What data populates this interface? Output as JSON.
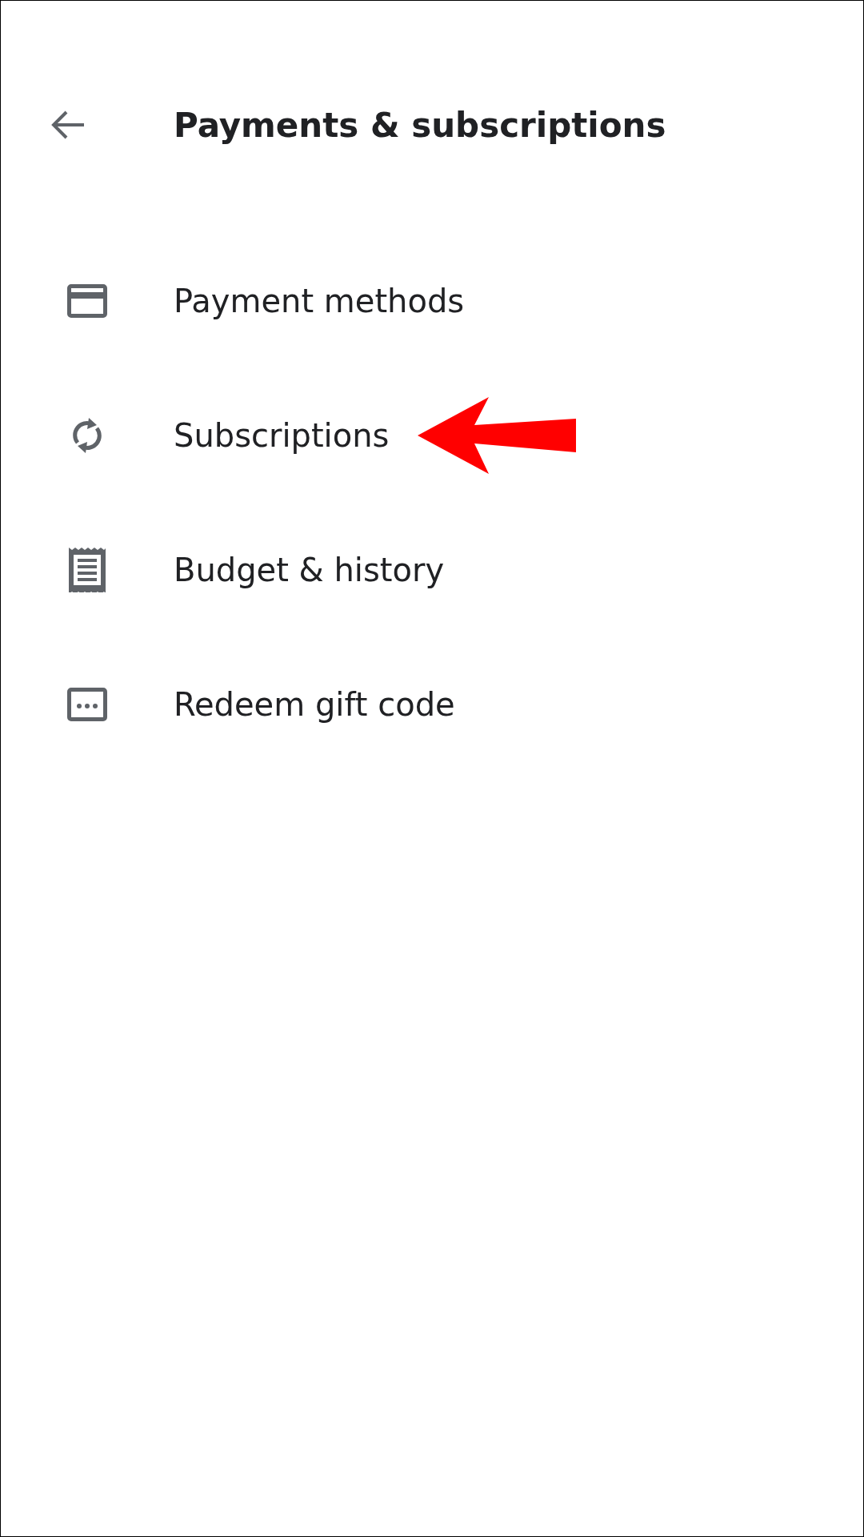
{
  "header": {
    "title": "Payments & subscriptions"
  },
  "items": [
    {
      "kind": "card",
      "label": "Payment methods",
      "pointed_at": false
    },
    {
      "kind": "sync",
      "label": "Subscriptions",
      "pointed_at": true
    },
    {
      "kind": "receipt",
      "label": "Budget & history",
      "pointed_at": false
    },
    {
      "kind": "code",
      "label": "Redeem gift code",
      "pointed_at": false
    }
  ]
}
